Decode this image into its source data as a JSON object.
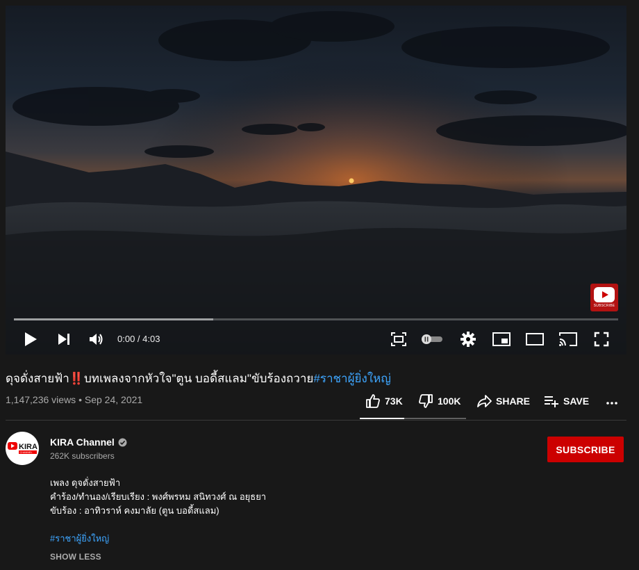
{
  "player": {
    "time_display": "0:00 / 4:03",
    "progress_fraction": 0.0,
    "loaded_fraction": 0.33,
    "channel_watermark_label": "SUBSCRIBE"
  },
  "video": {
    "title_main": "ดุจดั่งสายฟ้า‼️บทเพลงจากหัวใจ\"ตูน บอดี้สแลม\"ขับร้องถวาย",
    "title_hashtag": "#ราชาผู้ยิ่งใหญ่",
    "views": "1,147,236 views",
    "separator": "•",
    "date": "Sep 24, 2021"
  },
  "actions": {
    "like_count": "73K",
    "dislike_count": "100K",
    "share_label": "SHARE",
    "save_label": "SAVE",
    "like_ratio": 0.42
  },
  "channel": {
    "name": "KIRA Channel",
    "subscribers": "262K subscribers",
    "avatar_text": "KIRA",
    "avatar_subtext": "CHANNEL",
    "subscribe_label": "SUBSCRIBE"
  },
  "description": {
    "line1": "เพลง ดุจดั่งสายฟ้า",
    "line2": "คำร้อง/ทำนอง/เรียบเรียง : พงศ์พรหม สนิทวงศ์ ณ อยุธยา",
    "line3": "ขับร้อง : อาทิวราห์ คงมาลัย (ตูน บอดี้สแลม)",
    "hashtag": "#ราชาผู้ยิ่งใหญ่",
    "show_less_label": "SHOW LESS"
  },
  "colors": {
    "background": "#181818",
    "accent_red": "#cc0000",
    "link_blue": "#3ea6ff",
    "muted_text": "#aaaaaa"
  }
}
